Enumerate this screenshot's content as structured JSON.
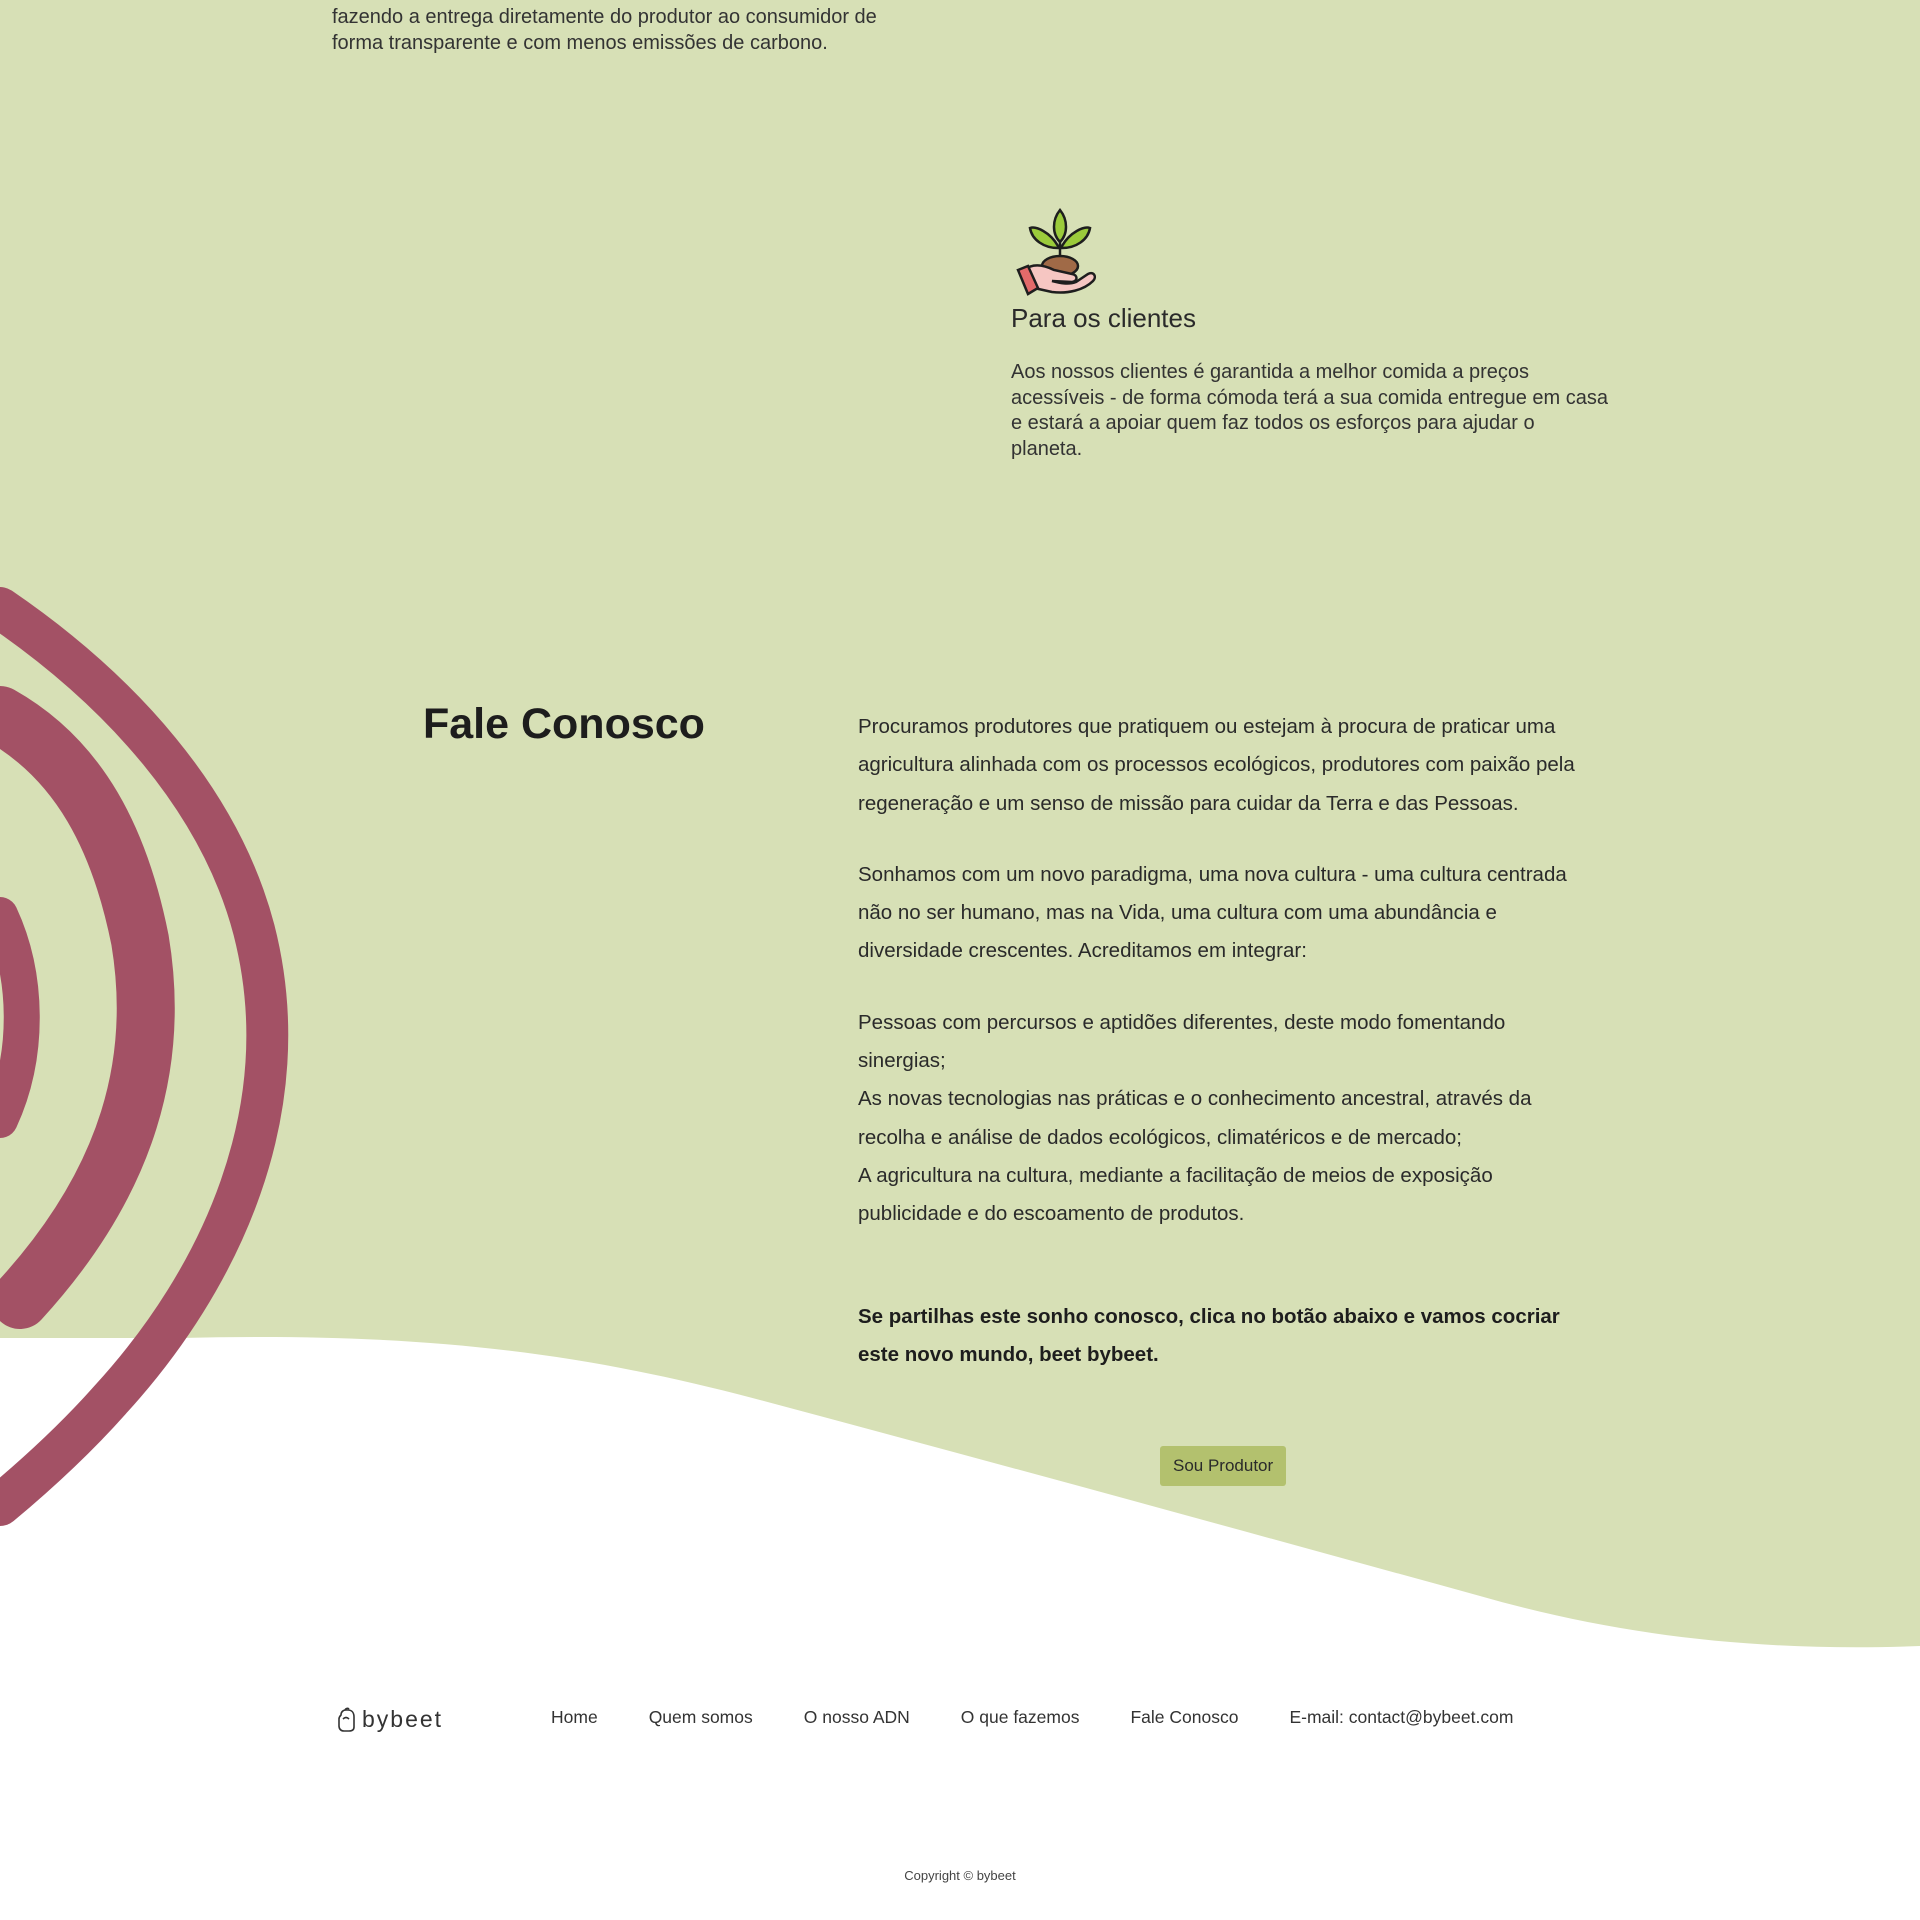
{
  "colors": {
    "background_green": "#d7e0b6",
    "accent_beet": "#a35165",
    "button_green": "#b3c16e"
  },
  "intro": {
    "lines": [
      "fazendo a entrega diretamente do produtor ao consumidor de",
      "forma transparente e com menos emissões de carbono."
    ]
  },
  "clients": {
    "icon": "hand-with-sprout-icon",
    "title": "Para os clientes",
    "body": "Aos nossos clientes é garantida a melhor comida a preços acessíveis - de forma cómoda terá a sua comida entregue em casa e estará a apoiar quem faz todos os esforços para ajudar o planeta."
  },
  "contact": {
    "title": "Fale Conosco",
    "paragraph1": "Procuramos produtores que pratiquem ou estejam à procura de praticar uma agricultura alinhada com os processos ecológicos, produtores com paixão pela regeneração e um senso de missão para cuidar da Terra e das Pessoas.",
    "paragraph2": "Sonhamos com um novo paradigma, uma nova cultura - uma cultura centrada não no ser humano, mas na Vida, uma cultura com uma abundância e diversidade crescentes. Acreditamos em integrar:",
    "list": [
      "Pessoas com percursos e aptidões diferentes, deste modo fomentando sinergias;",
      "As novas tecnologias nas práticas e o conhecimento ancestral, através da recolha e análise de dados ecológicos, climatéricos e de mercado;",
      "A agricultura na cultura, mediante a facilitação de meios de exposição publicidade e do escoamento de produtos."
    ],
    "call_to_action_text": "Se partilhas este sonho conosco, clica no botão abaixo e vamos cocriar este novo mundo, beet bybeet.",
    "button_label": "Sou Produtor"
  },
  "footer": {
    "logo_text": "bybeet",
    "logo_icon": "beet-logo-icon",
    "nav": [
      "Home",
      "Quem somos",
      "O nosso ADN",
      "O que fazemos",
      "Fale Conosco"
    ],
    "email": "E-mail: contact@bybeet.com",
    "copyright": "Copyright © bybeet"
  }
}
